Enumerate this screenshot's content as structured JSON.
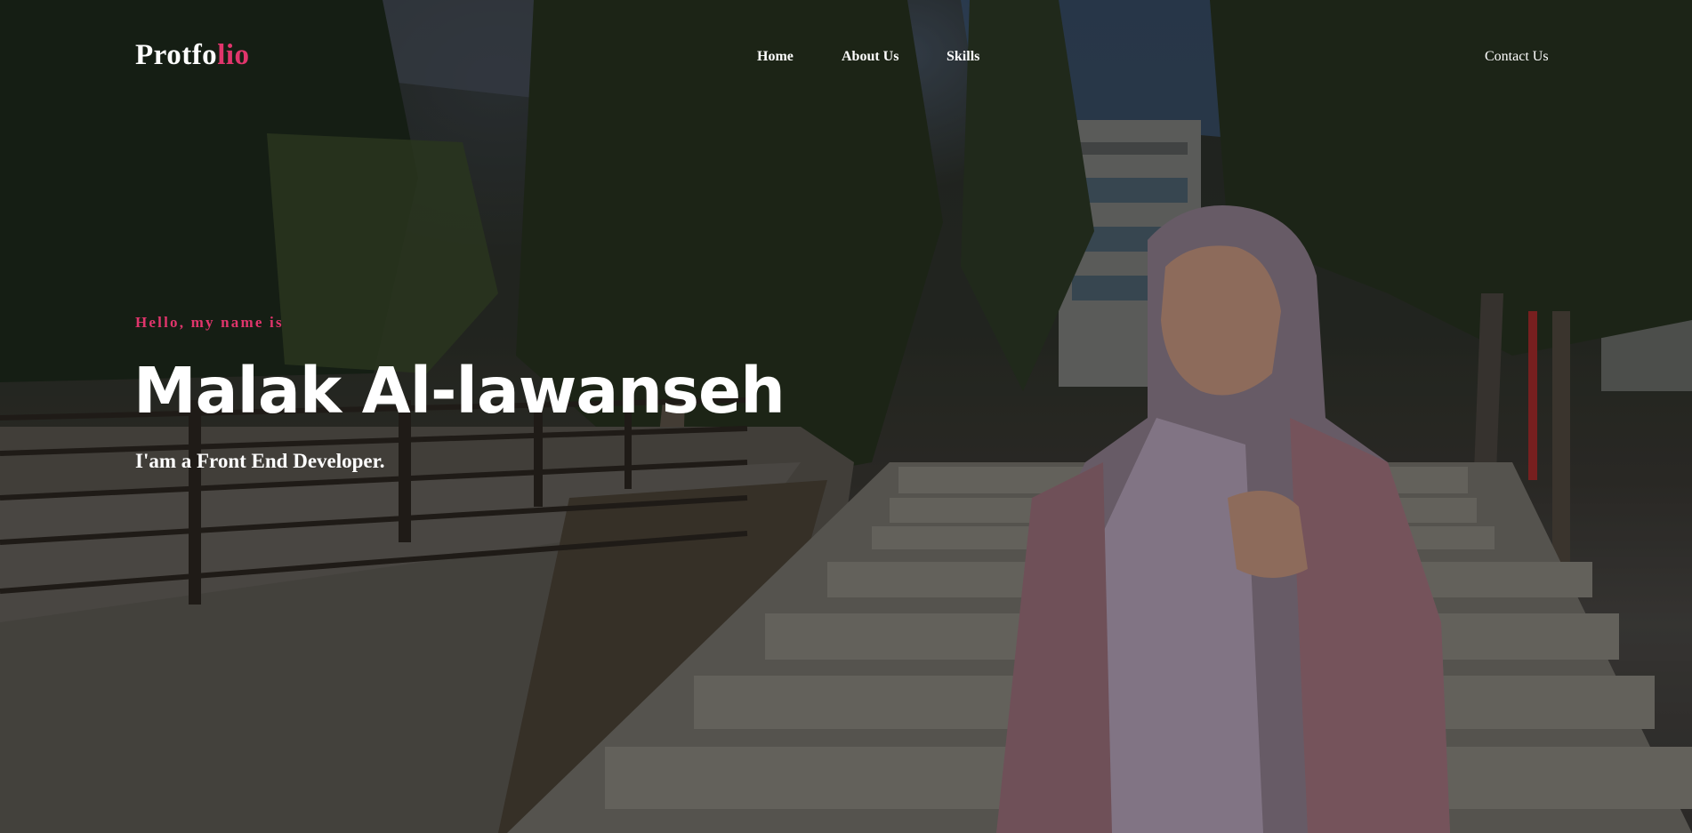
{
  "logo": {
    "part1": "Protfo",
    "part2": "lio"
  },
  "nav": {
    "home": "Home",
    "about": "About Us",
    "skills": "Skills",
    "contact": "Contact Us"
  },
  "hero": {
    "greeting": "Hello, my name is",
    "name": "Malak Al-lawanseh",
    "role": "I'am a Front End Developer."
  },
  "colors": {
    "accent": "#e0356c",
    "text": "#ffffff",
    "overlay": "rgba(0,0,0,0.28)"
  }
}
